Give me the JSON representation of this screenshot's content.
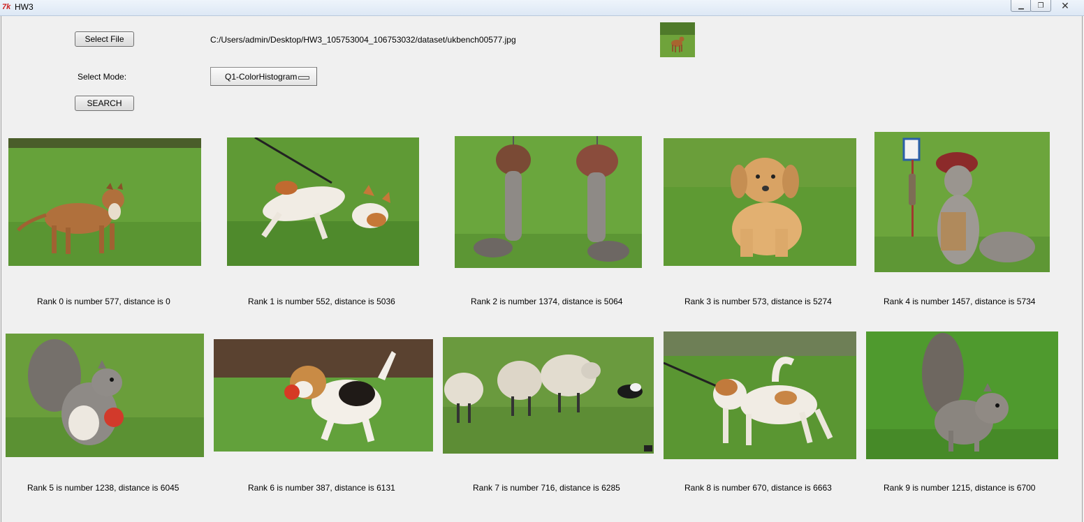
{
  "window": {
    "title": "HW3",
    "app_icon": "tk-feather-icon",
    "controls": [
      "minimize",
      "restore",
      "close"
    ]
  },
  "controls": {
    "select_file_label": "Select File",
    "file_path": "C:/Users/admin/Desktop/HW3_105753004_106753032/dataset/ukbench00577.jpg",
    "mode_label": "Select Mode:",
    "mode_value": "Q1-ColorHistogram",
    "search_label": "SEARCH"
  },
  "query_thumbnail": {
    "subject": "brown dog on grass"
  },
  "results": [
    {
      "caption": "Rank 0 is number 577, distance is 0",
      "subject": "brown puppy on grass"
    },
    {
      "caption": "Rank 1 is number 552, distance is 5036",
      "subject": "jack russell on leash"
    },
    {
      "caption": "Rank 2 is number 1374, distance is 5064",
      "subject": "two squirrels with coconuts"
    },
    {
      "caption": "Rank 3 is number 573, distance is 5274",
      "subject": "golden retriever puppy"
    },
    {
      "caption": "Rank 4 is number 1457, distance is 5734",
      "subject": "squirrel with hat at bus stop"
    },
    {
      "caption": "Rank 5 is number 1238, distance is 6045",
      "subject": "squirrel holding red ball"
    },
    {
      "caption": "Rank 6 is number 387, distance is 6131",
      "subject": "beagle puppy with ball"
    },
    {
      "caption": "Rank 7 is number 716, distance is 6285",
      "subject": "sheep herded by dog"
    },
    {
      "caption": "Rank 8 is number 670, distance is 6663",
      "subject": "jack russell on leash"
    },
    {
      "caption": "Rank 9 is number 1215, distance is 6700",
      "subject": "squirrel on grass"
    }
  ],
  "colors": {
    "grass": "#5f9a35",
    "grass_light": "#86b84c",
    "grass_dark": "#3f7424",
    "dog_brown": "#b06a38",
    "white": "#f3efe8",
    "squirrel_grey": "#8e8a86",
    "sky_far": "#5d6a3c"
  }
}
